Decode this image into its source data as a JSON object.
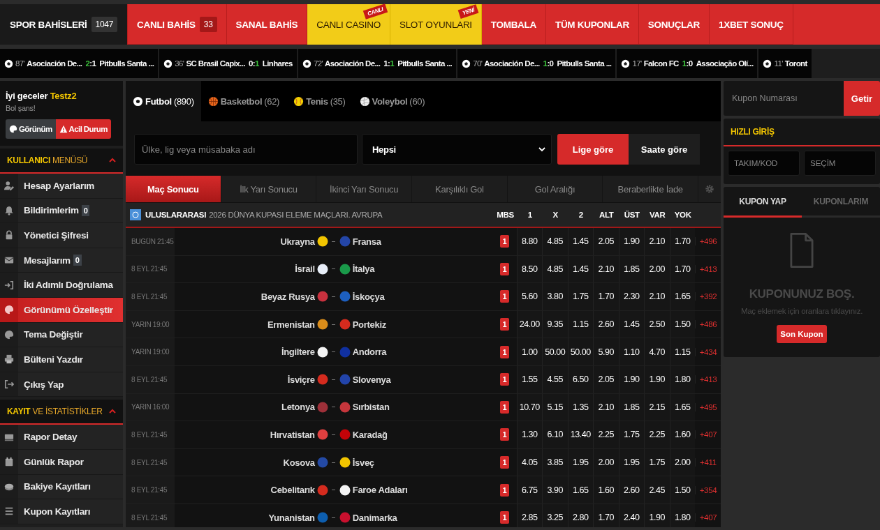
{
  "nav": {
    "items": [
      {
        "label": "SPOR BAHİSLERİ",
        "kind": "dark",
        "count": "1047"
      },
      {
        "label": "CANLI BAHİS",
        "kind": "red",
        "count": "33"
      },
      {
        "label": "SANAL BAHİS",
        "kind": "red"
      },
      {
        "label": "CANLI CASINO",
        "kind": "yellow",
        "ribbon": "CANLI"
      },
      {
        "label": "SLOT OYUNLARI",
        "kind": "yellow",
        "ribbon": "YENİ"
      },
      {
        "label": "TOMBALA",
        "kind": "red"
      },
      {
        "label": "TÜM KUPONLAR",
        "kind": "red"
      },
      {
        "label": "SONUÇLAR",
        "kind": "red"
      },
      {
        "label": "1XBET SONUÇ",
        "kind": "red"
      }
    ]
  },
  "ticker": [
    {
      "minute": "87'",
      "home": "Asociación De...",
      "score": [
        {
          "text": "2",
          "highlight": true
        },
        {
          "text": ":",
          "highlight": false
        },
        {
          "text": "1",
          "highlight": false
        }
      ],
      "away": "Pitbulls Santa ..."
    },
    {
      "minute": "36'",
      "home": "SC Brasil Capix...",
      "score": [
        {
          "text": "0",
          "highlight": false
        },
        {
          "text": ":",
          "highlight": false
        },
        {
          "text": "1",
          "highlight": true
        }
      ],
      "away": "Linhares"
    },
    {
      "minute": "72'",
      "home": "Asociación De...",
      "score": [
        {
          "text": "1",
          "highlight": false
        },
        {
          "text": ":",
          "highlight": false
        },
        {
          "text": "1",
          "highlight": true
        }
      ],
      "away": "Pitbulls Santa ..."
    },
    {
      "minute": "70'",
      "home": "Asociación De...",
      "score": [
        {
          "text": "1",
          "highlight": true
        },
        {
          "text": ":",
          "highlight": false
        },
        {
          "text": "0",
          "highlight": false
        }
      ],
      "away": "Pitbulls Santa ..."
    },
    {
      "minute": "17'",
      "home": "Falcon FC",
      "score": [
        {
          "text": "1",
          "highlight": true
        },
        {
          "text": ":",
          "highlight": false
        },
        {
          "text": "0",
          "highlight": false
        }
      ],
      "away": "Associação Olí..."
    },
    {
      "minute": "11'",
      "home": "Toront"
    }
  ],
  "sidebar": {
    "greeting": "İyi geceler",
    "username": "Testz2",
    "wish": "Bol şans!",
    "buttons": [
      {
        "label": "Görünüm",
        "kind": "dark"
      },
      {
        "label": "Acil Durum",
        "kind": "danger"
      }
    ],
    "sections": [
      {
        "title_strong": "KULLANICI",
        "title_rest": "MENÜSÜ",
        "items": [
          {
            "label": "Hesap Ayarlarım",
            "selected": false
          },
          {
            "label": "Bildirimlerim",
            "badge": "0",
            "selected": false
          },
          {
            "label": "Yönetici Şifresi",
            "selected": false
          },
          {
            "label": "Mesajlarım",
            "badge": "0",
            "selected": false
          },
          {
            "label": "İki Adımlı Doğrulama",
            "selected": false
          },
          {
            "label": "Görünümü Özelleştir",
            "selected": true
          },
          {
            "label": "Tema Değiştir",
            "selected": false
          },
          {
            "label": "Bülteni Yazdır",
            "selected": false
          },
          {
            "label": "Çıkış Yap",
            "selected": false
          }
        ]
      },
      {
        "title_strong": "KAYIT",
        "title_rest": "VE İSTATİSTİKLER",
        "items": [
          {
            "label": "Rapor Detay",
            "selected": false
          },
          {
            "label": "Günlük Rapor",
            "selected": false
          },
          {
            "label": "Bakiye Kayıtları",
            "selected": false
          },
          {
            "label": "Kupon Kayıtları",
            "selected": false
          }
        ]
      }
    ]
  },
  "sports": [
    {
      "name": "Futbol",
      "count": "(890)",
      "selected": true
    },
    {
      "name": "Basketbol",
      "count": "(62)",
      "selected": false
    },
    {
      "name": "Tenis",
      "count": "(35)",
      "selected": false
    },
    {
      "name": "Voleybol",
      "count": "(60)",
      "selected": false
    }
  ],
  "filter": {
    "search_placeholder": "Ülke, lig veya müsabaka adı",
    "select_value": "Hepsi",
    "sort": [
      {
        "label": "Lige göre",
        "selected": true
      },
      {
        "label": "Saate göre",
        "selected": false
      }
    ]
  },
  "markets": [
    {
      "label": "Maç Sonucu",
      "selected": true
    },
    {
      "label": "İlk Yarı Sonucu",
      "selected": false
    },
    {
      "label": "İkinci Yarı Sonucu",
      "selected": false
    },
    {
      "label": "Karşılıklı Gol",
      "selected": false
    },
    {
      "label": "Gol Aralığı",
      "selected": false
    },
    {
      "label": "Beraberlikte İade",
      "selected": false
    }
  ],
  "league": {
    "country": "ULUSLARARASI",
    "name": "2026 DÜNYA KUPASI ELEME MAÇLARI. AVRUPA",
    "columns": [
      "MBS",
      "1",
      "X",
      "2",
      "ALT",
      "ÜST",
      "VAR",
      "YOK"
    ]
  },
  "matches": [
    {
      "time": "BUGÜN 21:45",
      "home": {
        "name": "Ukrayna",
        "color": "#f2c500"
      },
      "away": {
        "name": "Fransa",
        "color": "#2446a8"
      },
      "mbs": "1",
      "odds": [
        "8.80",
        "4.85",
        "1.45",
        "2.05",
        "1.90",
        "2.10",
        "1.70"
      ],
      "more": "+496"
    },
    {
      "time": "8 EYL 21:45",
      "home": {
        "name": "İsrail",
        "color": "#e8eef8"
      },
      "away": {
        "name": "İtalya",
        "color": "#1a9a4a"
      },
      "mbs": "1",
      "odds": [
        "8.50",
        "4.85",
        "1.45",
        "2.10",
        "1.85",
        "2.00",
        "1.70"
      ],
      "more": "+413"
    },
    {
      "time": "8 EYL 21:45",
      "home": {
        "name": "Beyaz Rusya",
        "color": "#c8313e"
      },
      "away": {
        "name": "İskoçya",
        "color": "#1d5fbf"
      },
      "mbs": "1",
      "odds": [
        "5.60",
        "3.80",
        "1.75",
        "1.70",
        "2.30",
        "2.10",
        "1.65"
      ],
      "more": "+392"
    },
    {
      "time": "YARIN 19:00",
      "home": {
        "name": "Ermenistan",
        "color": "#d98c1a"
      },
      "away": {
        "name": "Portekiz",
        "color": "#d52b1e"
      },
      "mbs": "1",
      "odds": [
        "24.00",
        "9.35",
        "1.15",
        "2.60",
        "1.45",
        "2.50",
        "1.50"
      ],
      "more": "+486"
    },
    {
      "time": "YARIN 19:00",
      "home": {
        "name": "İngiltere",
        "color": "#f4f4f4"
      },
      "away": {
        "name": "Andorra",
        "color": "#1030a0"
      },
      "mbs": "1",
      "odds": [
        "1.00",
        "50.00",
        "50.00",
        "5.90",
        "1.10",
        "4.70",
        "1.15"
      ],
      "more": "+434"
    },
    {
      "time": "8 EYL 21:45",
      "home": {
        "name": "İsviçre",
        "color": "#d52b1e"
      },
      "away": {
        "name": "Slovenya",
        "color": "#2244aa"
      },
      "mbs": "1",
      "odds": [
        "1.55",
        "4.55",
        "6.50",
        "2.05",
        "1.90",
        "1.90",
        "1.80"
      ],
      "more": "+413"
    },
    {
      "time": "YARIN 16:00",
      "home": {
        "name": "Letonya",
        "color": "#9e3039"
      },
      "away": {
        "name": "Sırbistan",
        "color": "#c6363c"
      },
      "mbs": "1",
      "odds": [
        "10.70",
        "5.15",
        "1.35",
        "2.10",
        "1.85",
        "2.15",
        "1.65"
      ],
      "more": "+495"
    },
    {
      "time": "8 EYL 21:45",
      "home": {
        "name": "Hırvatistan",
        "color": "#e04040"
      },
      "away": {
        "name": "Karadağ",
        "color": "#c40308"
      },
      "mbs": "1",
      "odds": [
        "1.30",
        "6.10",
        "13.40",
        "2.25",
        "1.75",
        "2.25",
        "1.60"
      ],
      "more": "+407"
    },
    {
      "time": "8 EYL 21:45",
      "home": {
        "name": "Kosova",
        "color": "#244aa5"
      },
      "away": {
        "name": "İsveç",
        "color": "#f2c500"
      },
      "mbs": "1",
      "odds": [
        "4.05",
        "3.85",
        "1.95",
        "2.00",
        "1.95",
        "1.75",
        "2.00"
      ],
      "more": "+411"
    },
    {
      "time": "8 EYL 21:45",
      "home": {
        "name": "Cebelitarık",
        "color": "#d52b1e"
      },
      "away": {
        "name": "Faroe Adaları",
        "color": "#f4f4f4"
      },
      "mbs": "1",
      "odds": [
        "6.75",
        "3.90",
        "1.65",
        "1.60",
        "2.60",
        "2.45",
        "1.50"
      ],
      "more": "+354"
    },
    {
      "time": "8 EYL 21:45",
      "home": {
        "name": "Yunanistan",
        "color": "#0d5eaf"
      },
      "away": {
        "name": "Danimarka",
        "color": "#c8102e"
      },
      "mbs": "1",
      "odds": [
        "2.85",
        "3.25",
        "2.80",
        "1.70",
        "2.40",
        "1.90",
        "1.80"
      ],
      "more": "+407"
    }
  ],
  "coupon": {
    "number_placeholder": "Kupon Numarası",
    "fetch_button": "Getir",
    "quick_title": "HIZLI GİRİŞ",
    "quick_fields": [
      {
        "placeholder": "TAKIM/KOD"
      },
      {
        "placeholder": "SEÇİM"
      }
    ],
    "tabs": [
      {
        "label": "KUPON YAP",
        "selected": true
      },
      {
        "label": "KUPONLARIM",
        "selected": false
      }
    ],
    "empty_title": "KUPONUNUZ BOŞ.",
    "empty_text": "Maç eklemek için oranlara tıklayınız.",
    "last_button": "Son Kupon"
  }
}
